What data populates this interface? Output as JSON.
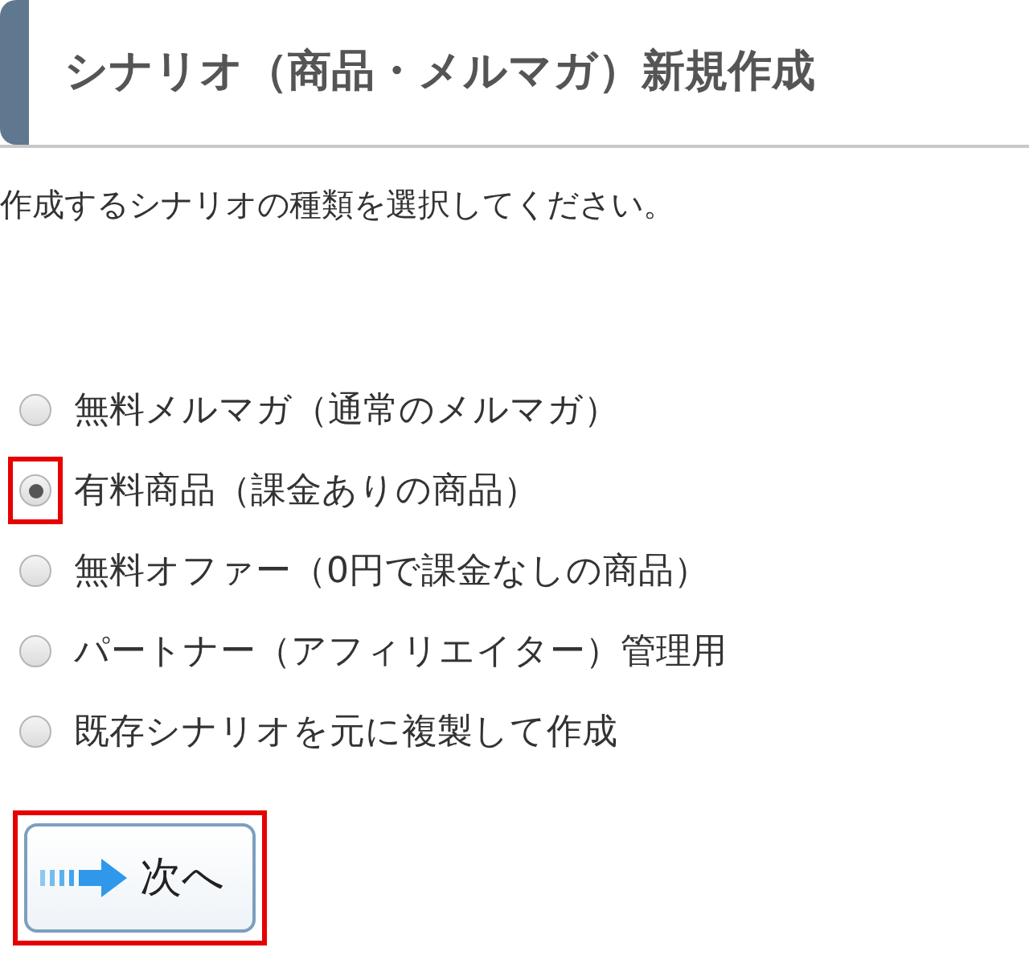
{
  "header": {
    "title": "シナリオ（商品・メルマガ）新規作成"
  },
  "instruction": "作成するシナリオの種類を選択してください。",
  "options": [
    {
      "label": "無料メルマガ（通常のメルマガ）",
      "selected": false,
      "highlighted": false
    },
    {
      "label": "有料商品（課金ありの商品）",
      "selected": true,
      "highlighted": true
    },
    {
      "label": "無料オファー（0円で課金なしの商品）",
      "selected": false,
      "highlighted": false
    },
    {
      "label": "パートナー（アフィリエイター）管理用",
      "selected": false,
      "highlighted": false
    },
    {
      "label": "既存シナリオを元に複製して作成",
      "selected": false,
      "highlighted": false
    }
  ],
  "next_button": {
    "label": "次へ",
    "highlighted": true
  }
}
